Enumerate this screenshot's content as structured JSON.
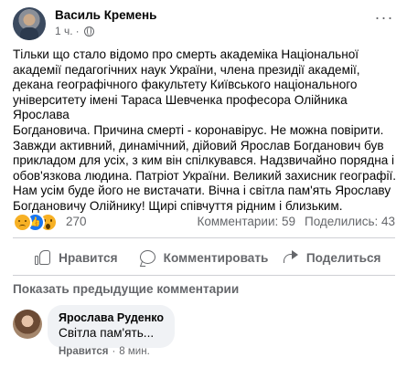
{
  "post": {
    "author": "Василь Кремень",
    "time": "1 ч.",
    "separator": "·",
    "more_icon": "ellipsis-icon",
    "privacy_icon": "globe-icon",
    "text": "Тільки що стало відомо про смерть  академіка Національної\nакадемії педагогічних наук України, члена президії академії,\nдекана географічного факультету Київського національного\nуніверситету імені Тараса Шевченка професора Олійника Ярослава\nБогдановича. Причина смерті -  коронавірус. Не можна повірити.\nЗавжди активний, динамічний, дійовий  Ярослав Богданович  був\nприкладом для усіх, з ким він спілкувався.  Надзвичайно порядна  і\nобов'язкова  людина. Патріот України. Великий  захисник географії.\nНам усім буде його не вистачати. Вічна і світла пам'ять Ярославу\nБогдановичу Олійнику! Щирі співчуття рідним і близьким."
  },
  "reactions": {
    "icons": [
      "sad-reaction-icon",
      "like-reaction-icon",
      "wow-reaction-icon"
    ],
    "count": "270",
    "comments": "Комментарии: 59",
    "shares": "Поделились: 43"
  },
  "actions": {
    "like": "Нравится",
    "comment": "Комментировать",
    "share": "Поделиться"
  },
  "comments_section": {
    "show_previous": "Показать предыдущие комментарии",
    "comment": {
      "author": "Ярослава Руденко",
      "text": "Світла пам'ять...",
      "like_label": "Нравится",
      "separator": "·",
      "time": "8 мин."
    }
  },
  "colors": {
    "text": "#050505",
    "secondary": "#65676b",
    "like_blue": "#1877f2",
    "reaction_yellow": "#f7b125",
    "comment_bg": "#f0f2f5"
  }
}
